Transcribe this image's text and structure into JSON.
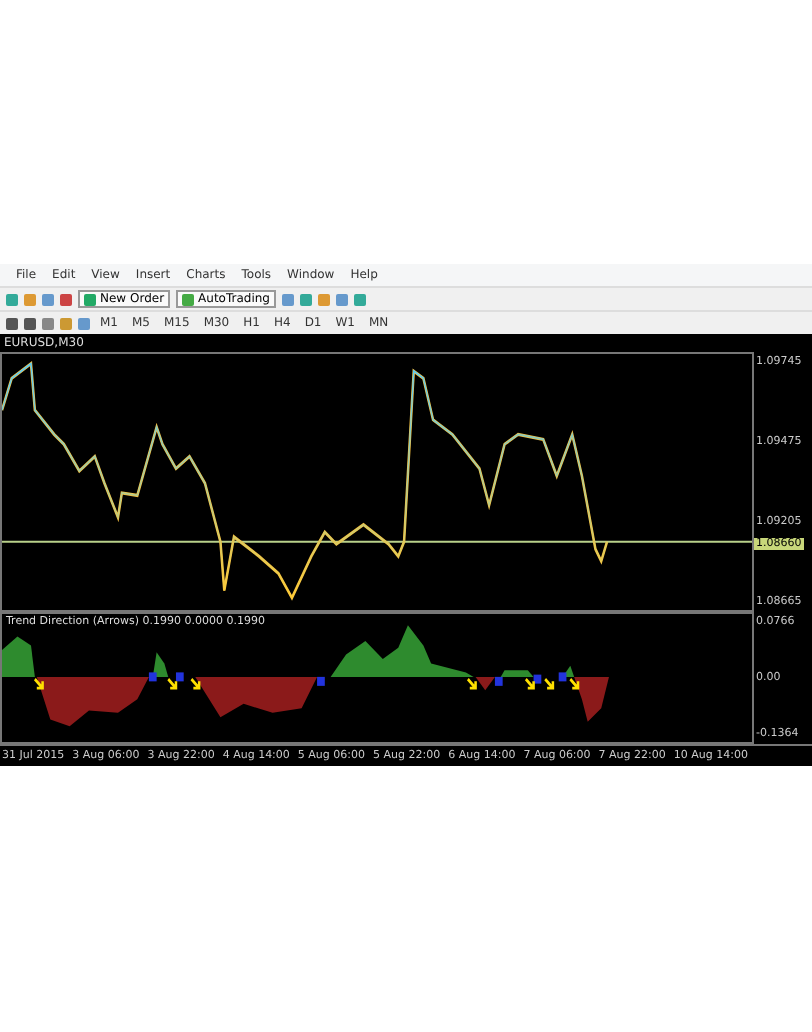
{
  "menu": [
    "File",
    "Edit",
    "View",
    "Insert",
    "Charts",
    "Tools",
    "Window",
    "Help"
  ],
  "toolbar": {
    "buttons": [
      "New Order",
      "AutoTrading"
    ]
  },
  "timeframes": [
    "M1",
    "M5",
    "M15",
    "M30",
    "H1",
    "H4",
    "D1",
    "W1",
    "MN"
  ],
  "chart": {
    "title": "EURUSD,M30",
    "price_labels": [
      "1.09745",
      "1.09475",
      "1.09205",
      "1.08665"
    ],
    "current_price": "1.08660"
  },
  "indicator": {
    "title": "Trend Direction (Arrows) 0.1990 0.0000 0.1990",
    "axis_labels": [
      "0.0766",
      "0.00",
      "-0.1364"
    ]
  },
  "time_labels": [
    "31 Jul 2015",
    "3 Aug 06:00",
    "3 Aug 22:00",
    "4 Aug 14:00",
    "5 Aug 06:00",
    "5 Aug 22:00",
    "6 Aug 14:00",
    "7 Aug 06:00",
    "7 Aug 22:00",
    "10 Aug 14:00"
  ]
}
